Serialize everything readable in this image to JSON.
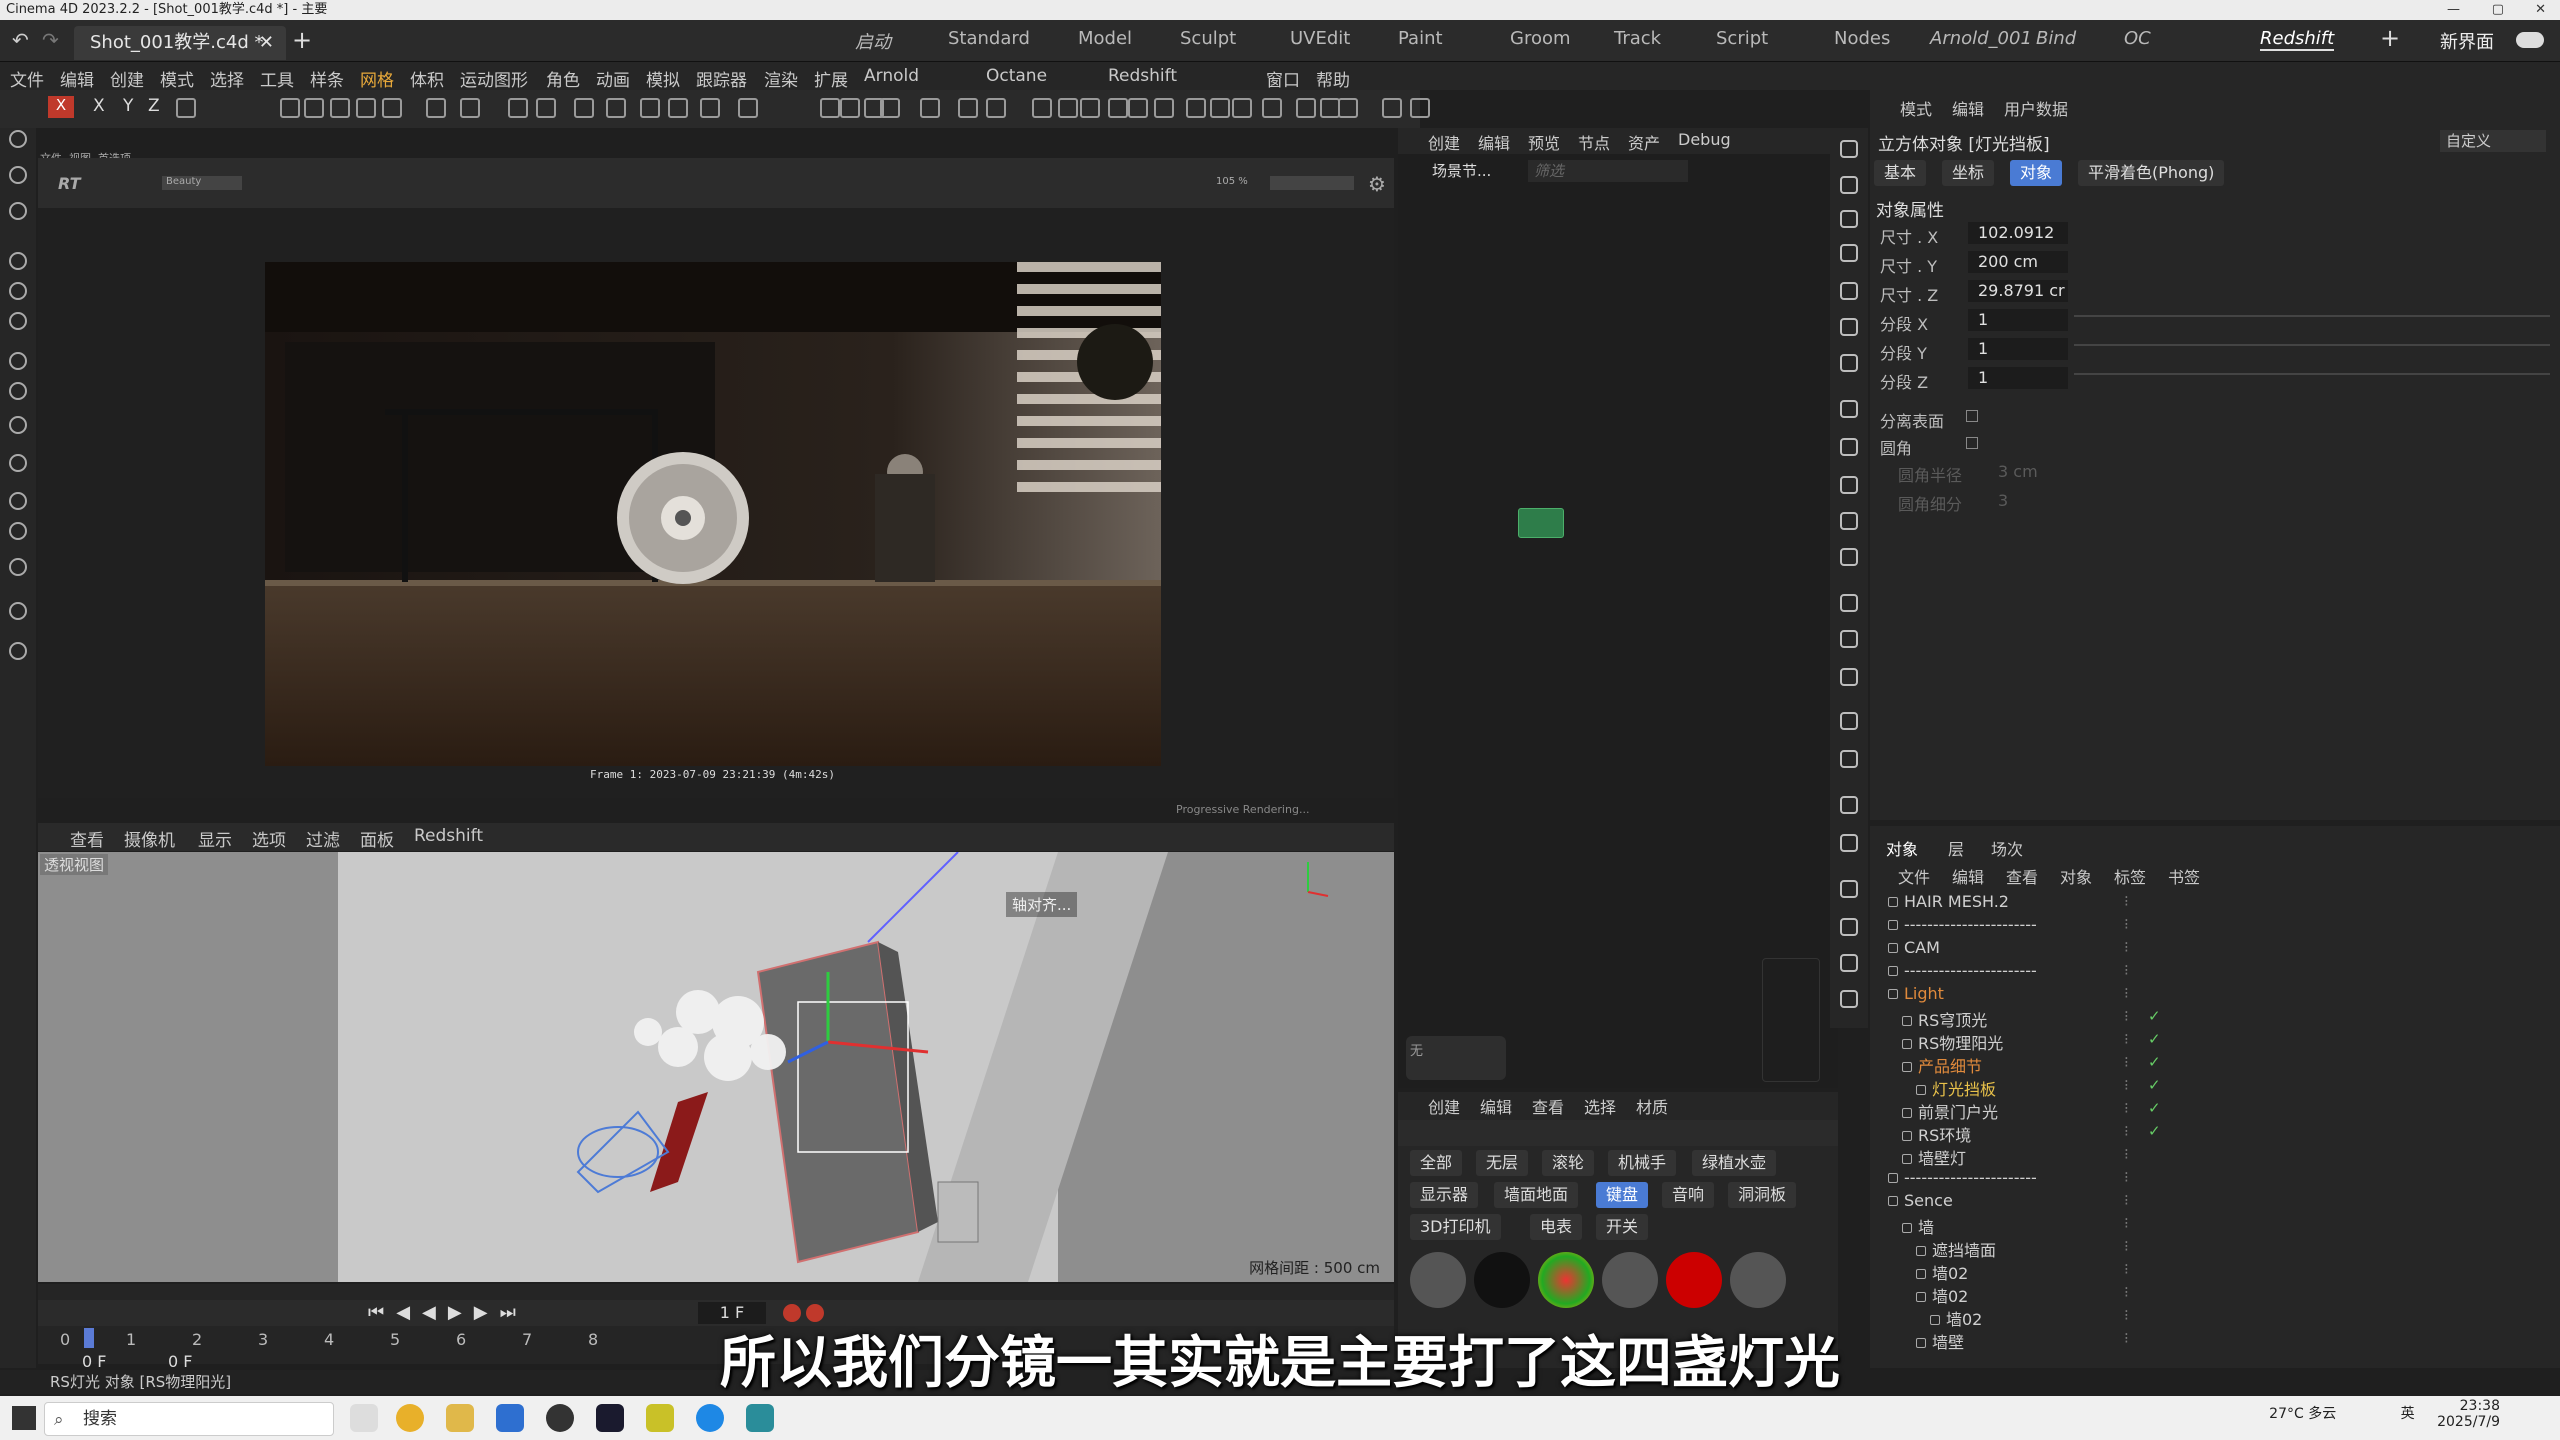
{
  "window": {
    "title": "Cinema 4D 2023.2.2 - [Shot_001教学.c4d *] - 主要"
  },
  "document_tab": {
    "label": "Shot_001教学.c4d *"
  },
  "layouts": [
    "Standard",
    "Model",
    "Sculpt",
    "UVEdit",
    "Paint",
    "Groom",
    "Track",
    "Script",
    "Nodes",
    "Arnold_001",
    "Bind",
    "OC",
    "Redshift"
  ],
  "layouts_italic": [
    "启动",
    "Arnold_001",
    "Bind",
    "OC"
  ],
  "layout_start": "启动",
  "new_interface": "新界面",
  "menu": [
    "文件",
    "编辑",
    "创建",
    "模式",
    "选择",
    "工具",
    "样条",
    "网格",
    "体积",
    "运动图形",
    "角色",
    "动画",
    "模拟",
    "跟踪器",
    "渲染",
    "扩展",
    "Arnold",
    "Octane",
    "Redshift",
    "窗口",
    "帮助"
  ],
  "menu_highlight": "网格",
  "axis_labels": [
    "X",
    "Y",
    "Z"
  ],
  "render_view": {
    "menu": [
      "文件",
      "视图",
      "首选项"
    ],
    "frame_text": "Frame  1:  2023-07-09  23:21:39  (4m:42s)",
    "progress": "Progressive Rendering...",
    "zoom": "105 %",
    "beauty": "Beauty"
  },
  "viewport": {
    "menu": [
      "查看",
      "摄像机",
      "显示",
      "选项",
      "过滤",
      "面板",
      "Redshift"
    ],
    "label": "透视视图",
    "align_btn": "轴对齐...",
    "grid_spacing": "网格间距 : 500 cm"
  },
  "timeline": {
    "frame_field": "1 F",
    "ticks": [
      "0",
      "1",
      "2",
      "3",
      "4",
      "5",
      "6",
      "7",
      "8"
    ],
    "start": "0 F",
    "end": "0 F"
  },
  "node_editor": {
    "menu": [
      "创建",
      "编辑",
      "预览",
      "节点",
      "资产",
      "Debug"
    ],
    "tab": "场景节...",
    "search_placeholder": "筛选",
    "node_label": "无"
  },
  "materials": {
    "menu": [
      "创建",
      "编辑",
      "查看",
      "选择",
      "材质"
    ],
    "filters_row1": [
      "全部",
      "无层",
      "滚轮",
      "机械手",
      "绿植水壶"
    ],
    "filters_row2": [
      "显示器",
      "墙面地面",
      "键盘",
      "音响",
      "洞洞板"
    ],
    "filters_row3": [
      "3D打印机",
      "电表",
      "开关"
    ],
    "active_filter": "键盘"
  },
  "attributes": {
    "menu": [
      "模式",
      "编辑",
      "用户数据"
    ],
    "object_title": "立方体对象 [灯光挡板]",
    "preset": "自定义",
    "tabs": [
      "基本",
      "坐标",
      "对象",
      "平滑着色(Phong)"
    ],
    "active_tab": "对象",
    "section": "对象属性",
    "fields": [
      {
        "label": "尺寸 . X",
        "value": "102.0912 c"
      },
      {
        "label": "尺寸 . Y",
        "value": "200 cm"
      },
      {
        "label": "尺寸 . Z",
        "value": "29.8791 cr"
      },
      {
        "label": "分段 X",
        "value": "1"
      },
      {
        "label": "分段 Y",
        "value": "1"
      },
      {
        "label": "分段 Z",
        "value": "1"
      }
    ],
    "checks": [
      {
        "label": "分离表面"
      },
      {
        "label": "圆角"
      }
    ],
    "disabled": [
      {
        "label": "圆角半径",
        "value": "3 cm"
      },
      {
        "label": "圆角细分",
        "value": "3"
      }
    ]
  },
  "object_manager": {
    "tabs": [
      "对象",
      "层",
      "场次"
    ],
    "menu": [
      "文件",
      "编辑",
      "查看",
      "对象",
      "标签",
      "书签"
    ],
    "items": [
      {
        "name": "HAIR MESH.2",
        "indent": 0,
        "color": "#d0d0d0"
      },
      {
        "name": "-----------------------",
        "indent": 0,
        "color": "#d0d0d0"
      },
      {
        "name": "CAM",
        "indent": 0,
        "color": "#d0d0d0"
      },
      {
        "name": "-----------------------",
        "indent": 0,
        "color": "#d0d0d0"
      },
      {
        "name": "Light",
        "indent": 0,
        "color": "#e08a3c"
      },
      {
        "name": "RS穹顶光",
        "indent": 1,
        "color": "#d0d0d0"
      },
      {
        "name": "RS物理阳光",
        "indent": 1,
        "color": "#d0d0d0"
      },
      {
        "name": "产品细节",
        "indent": 1,
        "color": "#e08a3c"
      },
      {
        "name": "灯光挡板",
        "indent": 2,
        "color": "#e8c14a"
      },
      {
        "name": "前景门户光",
        "indent": 1,
        "color": "#d0d0d0"
      },
      {
        "name": "RS环境",
        "indent": 1,
        "color": "#d0d0d0"
      },
      {
        "name": "墙壁灯",
        "indent": 1,
        "color": "#d0d0d0"
      },
      {
        "name": "-----------------------",
        "indent": 0,
        "color": "#d0d0d0"
      },
      {
        "name": "Sence",
        "indent": 0,
        "color": "#d0d0d0"
      },
      {
        "name": "墙",
        "indent": 1,
        "color": "#d0d0d0"
      },
      {
        "name": "遮挡墙面",
        "indent": 2,
        "color": "#d0d0d0"
      },
      {
        "name": "墙02",
        "indent": 2,
        "color": "#d0d0d0"
      },
      {
        "name": "墙02",
        "indent": 2,
        "color": "#d0d0d0"
      },
      {
        "name": "墙02",
        "indent": 3,
        "color": "#d0d0d0"
      },
      {
        "name": "墙壁",
        "indent": 2,
        "color": "#d0d0d0"
      }
    ]
  },
  "status": "RS灯光 对象 [RS物理阳光]",
  "subtitle": "所以我们分镜一其实就是主要打了这四盏灯光",
  "taskbar": {
    "search": "搜索",
    "weather": "27°C 多云",
    "lang": "英",
    "time": "23:38",
    "date": "2025/7/9"
  }
}
